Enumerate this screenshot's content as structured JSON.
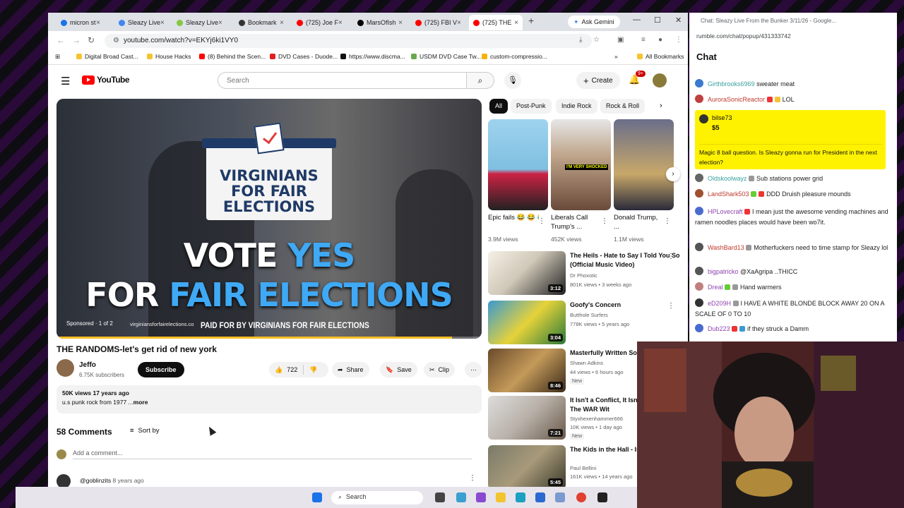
{
  "browser": {
    "tabs": [
      {
        "label": "micron st",
        "color": "#1a73e8"
      },
      {
        "label": "Sleazy Live",
        "color": "#4285f4"
      },
      {
        "label": "Sleazy Live",
        "color": "#85c742"
      },
      {
        "label": "Bookmark",
        "color": "#333333"
      },
      {
        "label": "(725) Joe F",
        "color": "#ff0000"
      },
      {
        "label": "MarsOfIsh",
        "color": "#000000"
      },
      {
        "label": "(725) FBI V",
        "color": "#ff0000"
      },
      {
        "label": "(725) THE",
        "color": "#ff0000"
      }
    ],
    "ask_gemini": "Ask Gemini",
    "url": "youtube.com/watch?v=EKYj6ki1VY0",
    "bookmarks": [
      {
        "label": "Digital Broad Cast...",
        "color": "#3b5998"
      },
      {
        "label": "House Hacks",
        "color": "#888888"
      },
      {
        "label": "(8) Behind the Scen...",
        "color": "#ff0000"
      },
      {
        "label": "DVD Cases - Duode...",
        "color": "#e02020"
      },
      {
        "label": "https://www.discma...",
        "color": "#111111"
      },
      {
        "label": "USDM DVD Case Tw...",
        "color": "#6aa84f"
      },
      {
        "label": "custom-compressio...",
        "color": "#f4b400"
      }
    ],
    "all_bookmarks": "All Bookmarks"
  },
  "youtube": {
    "logo_text": "YouTube",
    "search_placeholder": "Search",
    "create_label": "Create",
    "notif_badge": "9+",
    "video": {
      "ad_org_text": "VIRGINIANS FOR FAIR ELECTIONS",
      "ad_line1_a": "VOTE ",
      "ad_line1_b": "YES",
      "ad_line2_a": "FOR ",
      "ad_line2_b": "FAIR ELECTIONS",
      "paid_for": "PAID FOR BY VIRGINIANS FOR FAIR ELECTIONS",
      "sponsored": "Sponsored · 1 of 2",
      "sponsor_url": "virginiansforfairelections.co",
      "progress": 0.93
    },
    "title": "THE RANDOMS-let's get rid of new york",
    "channel": {
      "name": "Jeffo",
      "subs": "6.75K subscribers"
    },
    "subscribe_label": "Subscribe",
    "likes": "722",
    "share_label": "Share",
    "save_label": "Save",
    "clip_label": "Clip",
    "description": {
      "meta": "50K views  17 years ago",
      "text": "u.s punk rock from 1977 ...",
      "more": "more"
    },
    "comments_count": "58 Comments",
    "sort_by": "Sort by",
    "add_comment_placeholder": "Add a comment...",
    "first_comment": {
      "user": "@goblinzits",
      "time": "8 years ago"
    },
    "chips": [
      "All",
      "Post-Punk",
      "Indie Rock",
      "Rock & Roll"
    ],
    "shorts": [
      {
        "title": "Epic fails 😂 😂 😂 ...",
        "views": "3.9M views"
      },
      {
        "title": "Liberals Call Trump's ...",
        "views": "452K views"
      },
      {
        "title": "Donald Trump, ...",
        "views": "1.1M views"
      }
    ],
    "recommendations": [
      {
        "title": "The Heils - Hate to Say I Told You So (Official Music Video)",
        "channel": "Dr Phoxotic",
        "meta": "801K views • 3 weeks ago",
        "duration": "3:12",
        "badge": ""
      },
      {
        "title": "Goofy's Concern",
        "channel": "Butthole Surfers",
        "meta": "778K views • 5 years ago",
        "duration": "3:04",
        "badge": ""
      },
      {
        "title": "Masterfully Written Sor",
        "channel": "Shawn Adkins",
        "meta": "44 views • 6 hours ago",
        "duration": "8:46",
        "badge": "New"
      },
      {
        "title": "It Isn't a Conflict, It Isn't \"Strikes\"- The WAR Wit",
        "channel": "Styxhexenhammer666",
        "meta": "10K views • 1 day ago",
        "duration": "7:21",
        "badge": "New"
      },
      {
        "title": "The Kids in the Hall - Is Boys",
        "channel": "Paul Bellini",
        "meta": "161K views • 14 years ago",
        "duration": "5:45",
        "badge": ""
      }
    ]
  },
  "chat": {
    "window_title": "Chat: Sleazy Live From the Bunker 3/11/26 - Google...",
    "url": "rumble.com/chat/popup/431333742",
    "heading": "Chat",
    "messages": [
      {
        "user": "Girthbrooks6969",
        "text": "sweater meat",
        "color": "#3aa0a0"
      },
      {
        "user": "AuroraSonicReactor",
        "text": "LOL",
        "color": "#c0392b"
      },
      {
        "user": "Oldskoolwayz",
        "text": "Sub stations power grid",
        "color": "#3aa0a0"
      },
      {
        "user": "LandShark503",
        "text": "DDD Druish pleasure mounds",
        "color": "#c0392b"
      },
      {
        "user": "HPLovecraft",
        "text": "I mean just the awesome vending machines and ramen noodles places would have been wo7it.",
        "color": "#8e44ad"
      },
      {
        "user": "WashBard13",
        "text": "Motherfuckers need to time stamp for Sleazy lol",
        "color": "#c0392b"
      },
      {
        "user": "bigpatricko",
        "text": "@XaAgripa ..THICC",
        "color": "#8e44ad"
      },
      {
        "user": "Dreal",
        "text": "Hand warmers",
        "color": "#8e44ad"
      },
      {
        "user": "eD209H",
        "text": "I HAVE A WHITE BLONDE BLOCK AWAY 20 ON A SCALE OF 0 TO 10",
        "color": "#8e44ad"
      },
      {
        "user": "Dub223",
        "text": "if they struck a Damm",
        "color": "#8e44ad"
      }
    ],
    "donation": {
      "user": "bilse73",
      "amount": "$5",
      "text": "Magic 8 ball question. Is Sleazy gonna run for President in the next election?"
    }
  },
  "taskbar": {
    "search": "Search"
  }
}
